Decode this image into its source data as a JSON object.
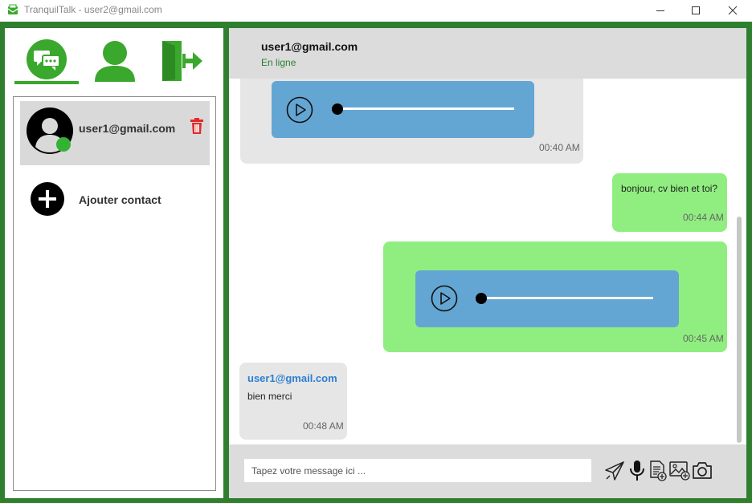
{
  "window": {
    "title": "TranquilTalk - user2@gmail.com",
    "accent_color": "#2f7f2f"
  },
  "nav": {
    "items": [
      {
        "name": "chats",
        "icon": "chat-bubbles-icon",
        "active": true
      },
      {
        "name": "profile",
        "icon": "user-icon",
        "active": false
      },
      {
        "name": "logout",
        "icon": "logout-door-icon",
        "active": false
      }
    ]
  },
  "contacts": {
    "items": [
      {
        "name": "user1@gmail.com",
        "online": true,
        "status_color": "#34b233",
        "delete_icon": "trash-icon"
      }
    ],
    "add_label": "Ajouter contact"
  },
  "chat": {
    "contact_name": "user1@gmail.com",
    "status": "En ligne",
    "messages": [
      {
        "direction": "received",
        "kind": "audio",
        "time": "00:40 AM"
      },
      {
        "direction": "sent",
        "kind": "text",
        "text": "bonjour, cv bien et toi?",
        "time": "00:44 AM"
      },
      {
        "direction": "sent",
        "kind": "audio",
        "time": "00:45 AM"
      },
      {
        "direction": "received",
        "kind": "text",
        "sender": "user1@gmail.com",
        "text": "bien merci",
        "time": "00:48 AM"
      }
    ]
  },
  "composer": {
    "placeholder": "Tapez votre message ici ...",
    "value": "",
    "tools": [
      "send-icon",
      "microphone-icon",
      "document-icon",
      "image-icon",
      "camera-icon"
    ]
  }
}
